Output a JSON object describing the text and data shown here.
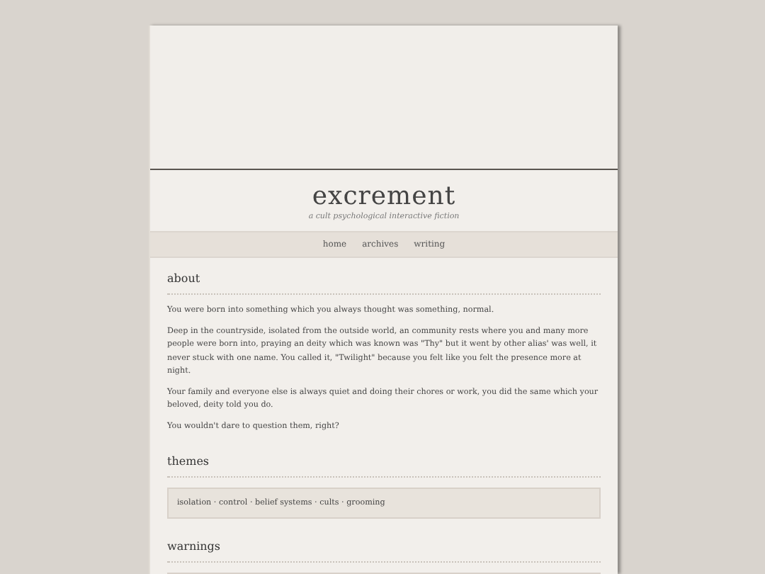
{
  "header": {
    "title": "excrement",
    "subtitle": "a cult psychological interactive fiction"
  },
  "nav": [
    {
      "label": "home"
    },
    {
      "label": "archives"
    },
    {
      "label": "writing"
    }
  ],
  "about": {
    "heading": "about",
    "paragraphs": [
      "You were born into something which you always thought was something, normal.",
      "Deep in the countryside, isolated from the outside world, an community rests where you and many more people were born into, praying an deity which was known was \"Thy\" but it went by other alias' was well, it never stuck with one name. You called it, \"Twilight\" because you felt like you felt the presence more at night.",
      "Your family and everyone else is always quiet and doing their chores or work, you did the same which your beloved, deity told you do.",
      "You wouldn't dare to question them, right?"
    ]
  },
  "themes": {
    "heading": "themes",
    "text": "isolation · control · belief systems · cults · grooming"
  },
  "warnings": {
    "heading": "warnings"
  }
}
